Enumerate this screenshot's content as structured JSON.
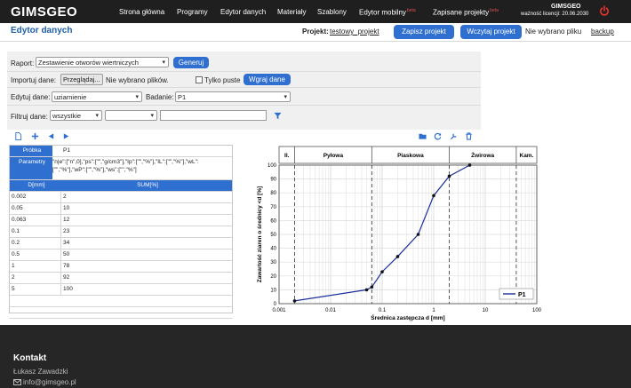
{
  "nav": {
    "logo": "GIMSGEO",
    "items": [
      {
        "label": "Strona główna",
        "beta": ""
      },
      {
        "label": "Programy",
        "beta": ""
      },
      {
        "label": "Edytor danych",
        "beta": ""
      },
      {
        "label": "Materiały",
        "beta": ""
      },
      {
        "label": "Szablony",
        "beta": ""
      },
      {
        "label": "Edytor mobilny",
        "beta": "beta"
      },
      {
        "label": "Zapisane projekty",
        "beta": "beta"
      }
    ],
    "license_name": "GIMSGEO",
    "license_date": "ważność licencji: 20.06.2030",
    "power_icon": "power-icon"
  },
  "header": {
    "title": "Edytor danych",
    "project_label": "Projekt:",
    "project_name": "testowy_projekt",
    "save_button": "Zapisz projekt",
    "load_button": "Wczytaj projekt",
    "no_file": "Nie wybrano pliku",
    "backup": "backup"
  },
  "form": {
    "report_label": "Raport:",
    "report_value": "Zestawienie otworów wiertniczych",
    "generate_button": "Generuj",
    "import_label": "Importuj dane:",
    "browse_button": "Przeglądaj...",
    "no_files": "Nie wybrano plików.",
    "only_empty_label": "Tylko puste",
    "load_data_button": "Wgraj dane",
    "edit_label": "Edytuj dane:",
    "edit_value": "uziarnienie",
    "test_label": "Badanie:",
    "test_value": "P1",
    "filter_label": "Filtruj dane:",
    "filter_value": "wszystkie",
    "filter_op_value": "",
    "filter_text": ""
  },
  "toolbar": {
    "left_icons": [
      "new-file-icon",
      "add-icon",
      "previous-icon",
      "next-icon"
    ],
    "right_icons": [
      "folder-icon",
      "refresh-icon",
      "tools-icon",
      "trash-icon"
    ]
  },
  "table": {
    "sample_label": "Próbka",
    "sample_value": "P1",
    "params_label": "Parametry",
    "params_value": "\"n|e\":[\"n\",0],\"ps\":[\"\",\"g/cm3\"],\"Ip\":[\"\",\"%\"],\"IL\":[\"\",\"%\"],\"wL\":[\"\",\"%\"],\"wP\":[\"\",\"%\"],\"ws\":[\"\",\"%\"]",
    "col_d": "D[mm]",
    "col_sum": "SUM[%]",
    "rows": [
      {
        "d": "0.002",
        "sum": "2"
      },
      {
        "d": "0.05",
        "sum": "10"
      },
      {
        "d": "0.063",
        "sum": "12"
      },
      {
        "d": "0.1",
        "sum": "23"
      },
      {
        "d": "0.2",
        "sum": "34"
      },
      {
        "d": "0.5",
        "sum": "50"
      },
      {
        "d": "1",
        "sum": "78"
      },
      {
        "d": "2",
        "sum": "92"
      },
      {
        "d": "5",
        "sum": "100"
      }
    ]
  },
  "chart_data": {
    "type": "line",
    "xscale": "log",
    "xlim": [
      0.001,
      100
    ],
    "ylim": [
      0,
      100
    ],
    "xlabel": "Średnica zastępcza d [mm]",
    "ylabel": "Zawartość ziaren o średnicy <d [%]",
    "x_ticks": [
      "0.001",
      "0.01",
      "0.1",
      "1",
      "10",
      "100"
    ],
    "y_ticks": [
      "0",
      "10",
      "20",
      "30",
      "40",
      "50",
      "60",
      "70",
      "80",
      "90",
      "100"
    ],
    "grid": true,
    "fraction_bands": [
      {
        "label": "Il.",
        "from": 0.001,
        "to": 0.002
      },
      {
        "label": "Pyłowa",
        "from": 0.002,
        "to": 0.063
      },
      {
        "label": "Piaskowa",
        "from": 0.063,
        "to": 2
      },
      {
        "label": "Żwirowa",
        "from": 2,
        "to": 40
      },
      {
        "label": "Kam.",
        "from": 40,
        "to": 100
      }
    ],
    "boundaries": [
      0.002,
      0.063,
      2,
      40
    ],
    "legend_position": "bottom-right",
    "series": [
      {
        "name": "P1",
        "color": "#1a2f9c",
        "x": [
          0.002,
          0.05,
          0.063,
          0.1,
          0.2,
          0.5,
          1,
          2,
          5
        ],
        "y": [
          2,
          10,
          12,
          23,
          34,
          50,
          78,
          92,
          100
        ]
      }
    ]
  },
  "footer": {
    "title": "Kontakt",
    "name": "Łukasz Zawadzki",
    "email": "info@gimsgeo.pl"
  }
}
